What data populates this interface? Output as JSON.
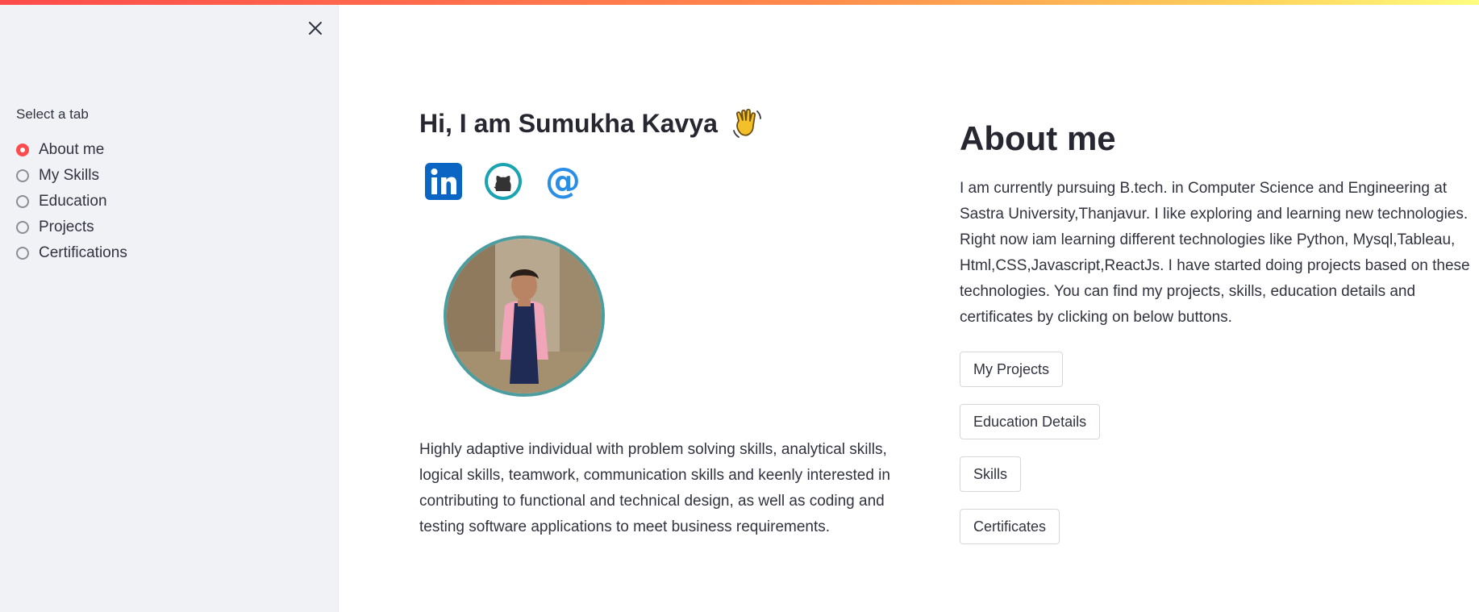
{
  "sidebar": {
    "radio_label": "Select a tab",
    "options": [
      {
        "label": "About me",
        "selected": true
      },
      {
        "label": "My Skills",
        "selected": false
      },
      {
        "label": "Education",
        "selected": false
      },
      {
        "label": "Projects",
        "selected": false
      },
      {
        "label": "Certifications",
        "selected": false
      }
    ],
    "close_icon": "close-icon"
  },
  "hero": {
    "greeting": "Hi, I am Sumukha Kavya",
    "greeting_icon": "waving-hand-icon",
    "social_links": [
      {
        "icon": "linkedin-icon",
        "color": "#0a66c2"
      },
      {
        "icon": "github-icon",
        "color": "#1aa3b0"
      },
      {
        "icon": "email-at-icon",
        "color": "#2a8ee6"
      }
    ],
    "avatar_icon": "profile-photo",
    "bio": "Highly adaptive individual with problem solving skills, analytical skills, logical skills, teamwork, communication skills and keenly interested in contributing to functional and technical design, as well as coding and testing software applications to meet business requirements."
  },
  "about": {
    "title": "About me",
    "description": "I am currently pursuing B.tech. in Computer Science and Engineering at Sastra University,Thanjavur. I like exploring and learning new technologies. Right now iam learning different technologies like Python, Mysql,Tableau, Html,CSS,Javascript,ReactJs. I have started doing projects based on these technologies. You can find my projects, skills, education details and certificates by clicking on below buttons.",
    "buttons": [
      "My Projects",
      "Education Details",
      "Skills",
      "Certificates"
    ]
  },
  "colors": {
    "accent": "#ff4b4b",
    "sidebar_bg": "#f0f2f6",
    "avatar_border": "#4b9d9f"
  }
}
